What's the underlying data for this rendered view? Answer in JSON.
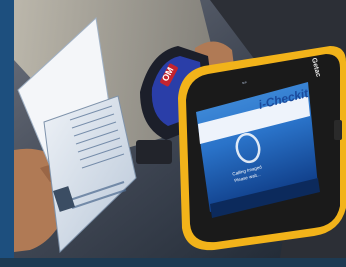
{
  "tablet": {
    "brand": "Getac",
    "app_logo": "i-Checkit",
    "status_bar": "==",
    "message_line1": "Calling Imaged",
    "message_line2": "Please wait..."
  },
  "scanner": {
    "brand": "OM"
  },
  "colors": {
    "tablet_frame": "#f2b31a",
    "tablet_body": "#1a1a1a",
    "screen_bg": "#2a73c9",
    "scanner_body": "#2a3ea8",
    "scanner_accent": "#c4242f",
    "passport_page": "#dfe6ef",
    "backdrop": "#1d3a52"
  }
}
